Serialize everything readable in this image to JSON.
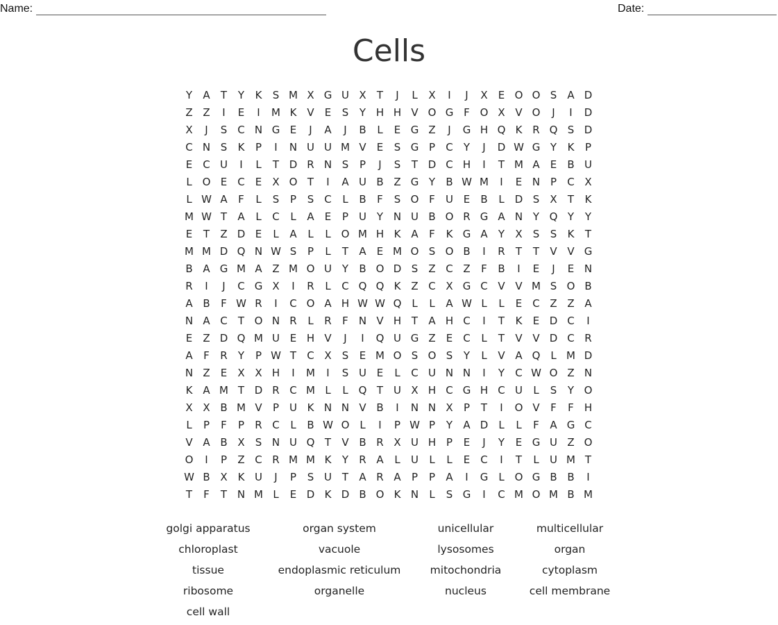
{
  "header": {
    "name_label": "Name:",
    "date_label": "Date:",
    "title": "Cells"
  },
  "grid": [
    "YATYKSMXGUXTJLXIJXEOOSAD",
    "ZZIEIMKVESYHHVOGFOXVOJID",
    "XJSCNGEJAJBLEGZJGHQKRQSD",
    "CNSKPINUUMVESGPCYJDWGYKP",
    "ECUILTDRNSPJSTDCHITMAEBU",
    "LOECEXOTIAUBZGYBWMIENPCX",
    "LWAFLSPSCLBFSOFUEBLDSXTK",
    "MWTALCLAEPUYNUBORGANYQYY",
    "ETZDELALLOMHKAFKGAYXSSKT",
    "MMDQNWSPLTAEMOSOBIRTTVVG",
    "BAGMAZMOUYBODSZCZFBIEJEN",
    "RIJCGXIRLCQQKZCXGCVVMSOB",
    "ABFWRICOAHWWQLLAWLLECZZA",
    "NACTONRLRFNVHTAHCITKEDCI",
    "EZDQMUEHVJIQUGZECLTVVDCR",
    "AFRYPWTCXSEMOSOSYLVAQLMD",
    "NZEXXHIMISUELCUNNIYCWOZN",
    "KAMTDRCMLLQTUXHCGHCULSYO",
    "XXBMVPUKNNVBINNXPTIOVFFH",
    "LPFPRCLBWOLIPWPYADLLFAGC",
    "VABXSNUQTVBRXUHPEJYEGUZO",
    "OIPZCRMMKYRALULLECITLUMT",
    "WBXKUJPSUTARAPPAIGLOGBBI",
    "TFTNMLEDKDBOKNLSGICMOMBM"
  ],
  "word_list": [
    [
      "golgi apparatus",
      "organ system",
      "unicellular",
      "multicellular"
    ],
    [
      "chloroplast",
      "vacuole",
      "lysosomes",
      "organ"
    ],
    [
      "tissue",
      "endoplasmic reticulum",
      "mitochondria",
      "cytoplasm"
    ],
    [
      "ribosome",
      "organelle",
      "nucleus",
      "cell membrane"
    ],
    [
      "cell wall"
    ]
  ]
}
